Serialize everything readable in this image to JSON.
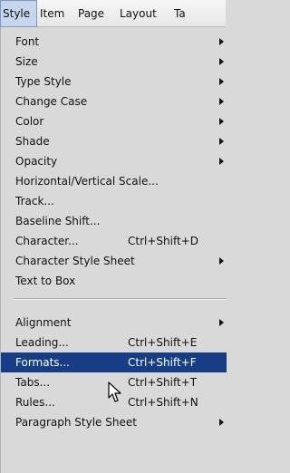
{
  "menubar": {
    "items": [
      {
        "label": "Style",
        "active": true
      },
      {
        "label": "Item",
        "active": false
      },
      {
        "label": "Page",
        "active": false
      },
      {
        "label": "Layout",
        "active": false
      },
      {
        "label": "Ta",
        "active": false
      }
    ]
  },
  "menu": {
    "group1": [
      {
        "label": "Font",
        "submenu": true
      },
      {
        "label": "Size",
        "submenu": true
      },
      {
        "label": "Type Style",
        "submenu": true
      },
      {
        "label": "Change Case",
        "submenu": true
      },
      {
        "label": "Color",
        "submenu": true
      },
      {
        "label": "Shade",
        "submenu": true
      },
      {
        "label": "Opacity",
        "submenu": true
      },
      {
        "label": "Horizontal/Vertical Scale...",
        "submenu": false
      },
      {
        "label": "Track...",
        "submenu": false
      },
      {
        "label": "Baseline Shift...",
        "submenu": false
      },
      {
        "label": "Character...",
        "shortcut": "Ctrl+Shift+D",
        "submenu": false
      },
      {
        "label": "Character Style Sheet",
        "submenu": true
      },
      {
        "label": "Text to Box",
        "submenu": false
      }
    ],
    "group2": [
      {
        "label": "Alignment",
        "submenu": true
      },
      {
        "label": "Leading...",
        "shortcut": "Ctrl+Shift+E",
        "submenu": false
      },
      {
        "label": "Formats...",
        "shortcut": "Ctrl+Shift+F",
        "submenu": false,
        "highlighted": true
      },
      {
        "label": "Tabs...",
        "shortcut": "Ctrl+Shift+T",
        "submenu": false
      },
      {
        "label": "Rules...",
        "shortcut": "Ctrl+Shift+N",
        "submenu": false
      },
      {
        "label": "Paragraph Style Sheet",
        "submenu": true
      }
    ]
  },
  "colors": {
    "highlight": "#183d87",
    "menu_bg": "#d9d9d9"
  },
  "icons": {
    "cursor": "arrow-cursor-icon",
    "submenu": "submenu-arrow-icon"
  }
}
